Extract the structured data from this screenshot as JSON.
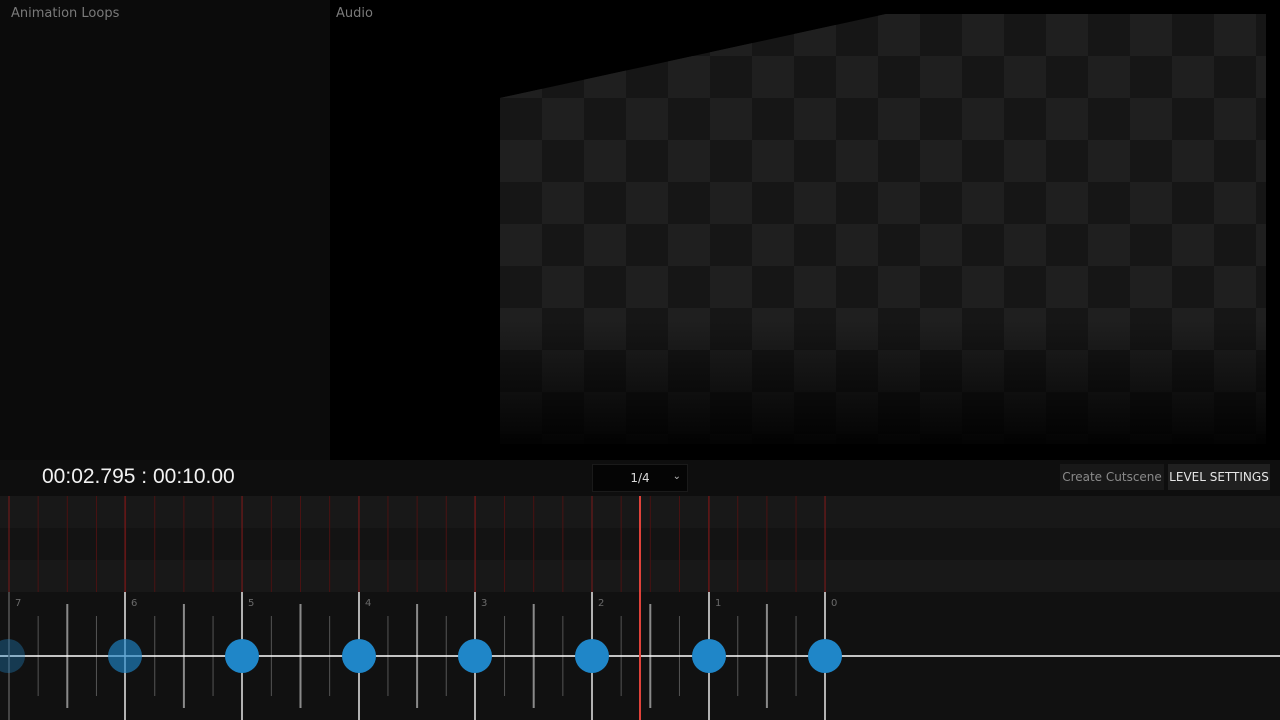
{
  "panels": {
    "left_title": "Animation Loops",
    "mid_title": "Audio"
  },
  "toolbar": {
    "time_current": "00:02.795",
    "time_separator": ":",
    "time_total": "00:10.00",
    "page_select": {
      "value": "1/4"
    },
    "create_cutscene_label": "Create Cutscene",
    "level_settings_label": "LEVEL SETTINGS"
  },
  "timeline": {
    "markers": [
      "7",
      "6",
      "5",
      "4",
      "3",
      "2",
      "1",
      "0"
    ],
    "keyframe_color": "#1f86c8",
    "playhead_color": "#e0423a"
  }
}
